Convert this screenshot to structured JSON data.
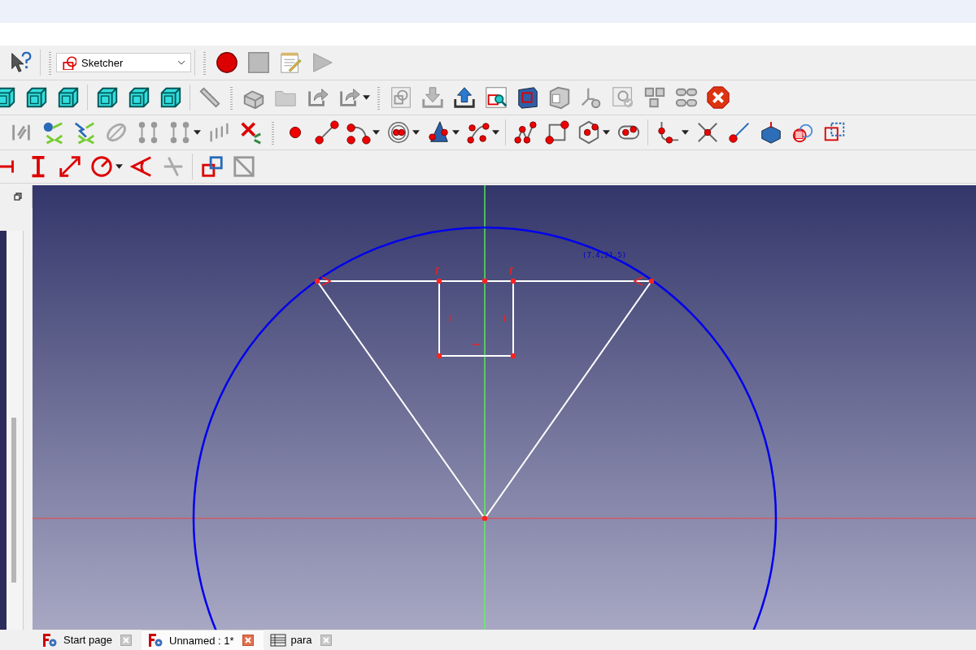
{
  "toolbar": {
    "workbench": "Sketcher"
  },
  "viewport": {
    "cursor_coordinates": "(7.4,21.5)"
  },
  "tabs": [
    {
      "label": "Start page",
      "kind": "document",
      "selected": false
    },
    {
      "label": "Unnamed : 1*",
      "kind": "document",
      "selected": true
    },
    {
      "label": "para",
      "kind": "spreadsheet",
      "selected": false
    }
  ]
}
